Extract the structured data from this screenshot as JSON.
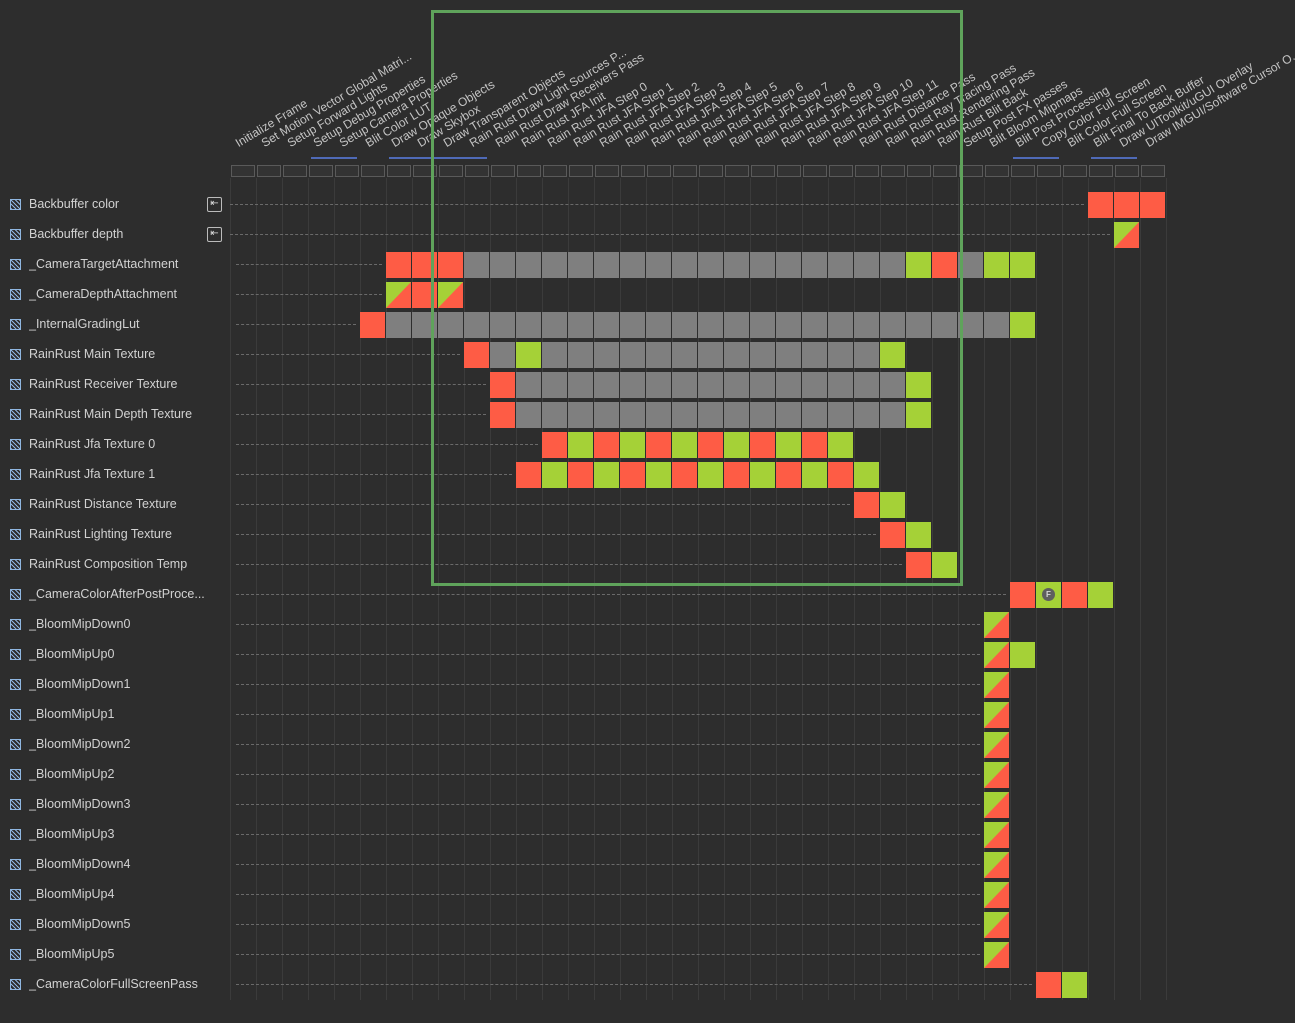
{
  "passes": [
    "Initialize Frame",
    "Set Motion Vector Global Matri...",
    "Setup Forward Lights",
    "Setup Debug Properties",
    "Setup Camera Properties",
    "Blit Color LUT",
    "Draw Opaque Objects",
    "Draw Skybox",
    "Draw Transparent Objects",
    "Rain Rust Draw Light Sources P...",
    "Rain Rust Draw Receivers Pass",
    "Rain Rust JFA Init",
    "Rain Rust JFA Step 0",
    "Rain Rust JFA Step 1",
    "Rain Rust JFA Step 2",
    "Rain Rust JFA Step 3",
    "Rain Rust JFA Step 4",
    "Rain Rust JFA Step 5",
    "Rain Rust JFA Step 6",
    "Rain Rust JFA Step 7",
    "Rain Rust JFA Step 8",
    "Rain Rust JFA Step 9",
    "Rain Rust JFA Step 10",
    "Rain Rust JFA Step 11",
    "Rain Rust Distance Pass",
    "Rain Rust Ray Tracing Pass",
    "Rain Rust Rendering Pass",
    "Rain Rust Blit Back",
    "Setup Post FX passes",
    "Blit Bloom Mipmaps",
    "Blit Post Processing",
    "Copy Color Full Screen",
    "Blit Color Full Screen",
    "Blit Final To Back Buffer",
    "Draw UIToolkit/uGUI Overlay",
    "Draw IMGUI/Software Cursor O..."
  ],
  "merged_pass_groups": [
    [
      3,
      4
    ],
    [
      6,
      9
    ],
    [
      30,
      31
    ],
    [
      33,
      34
    ]
  ],
  "resources": [
    {
      "name": "Backbuffer color",
      "imported": true,
      "cells": [
        [
          33,
          "w"
        ],
        [
          34,
          "w"
        ],
        [
          35,
          "w"
        ]
      ]
    },
    {
      "name": "Backbuffer depth",
      "imported": true,
      "cells": [
        [
          34,
          "rw"
        ]
      ]
    },
    {
      "name": "_CameraTargetAttachment",
      "imported": false,
      "cells": [
        [
          6,
          "w"
        ],
        [
          7,
          "w"
        ],
        [
          8,
          "w"
        ],
        [
          9,
          "g"
        ],
        [
          10,
          "g"
        ],
        [
          11,
          "g"
        ],
        [
          12,
          "g"
        ],
        [
          13,
          "g"
        ],
        [
          14,
          "g"
        ],
        [
          15,
          "g"
        ],
        [
          16,
          "g"
        ],
        [
          17,
          "g"
        ],
        [
          18,
          "g"
        ],
        [
          19,
          "g"
        ],
        [
          20,
          "g"
        ],
        [
          21,
          "g"
        ],
        [
          22,
          "g"
        ],
        [
          23,
          "g"
        ],
        [
          24,
          "g"
        ],
        [
          25,
          "g"
        ],
        [
          26,
          "r"
        ],
        [
          27,
          "w"
        ],
        [
          28,
          "g"
        ],
        [
          29,
          "r"
        ],
        [
          30,
          "r"
        ]
      ]
    },
    {
      "name": "_CameraDepthAttachment",
      "imported": false,
      "cells": [
        [
          6,
          "rw"
        ],
        [
          7,
          "w"
        ],
        [
          8,
          "rw"
        ]
      ]
    },
    {
      "name": "_InternalGradingLut",
      "imported": false,
      "cells": [
        [
          5,
          "w"
        ],
        [
          6,
          "g"
        ],
        [
          7,
          "g"
        ],
        [
          8,
          "g"
        ],
        [
          9,
          "g"
        ],
        [
          10,
          "g"
        ],
        [
          11,
          "g"
        ],
        [
          12,
          "g"
        ],
        [
          13,
          "g"
        ],
        [
          14,
          "g"
        ],
        [
          15,
          "g"
        ],
        [
          16,
          "g"
        ],
        [
          17,
          "g"
        ],
        [
          18,
          "g"
        ],
        [
          19,
          "g"
        ],
        [
          20,
          "g"
        ],
        [
          21,
          "g"
        ],
        [
          22,
          "g"
        ],
        [
          23,
          "g"
        ],
        [
          24,
          "g"
        ],
        [
          25,
          "g"
        ],
        [
          26,
          "g"
        ],
        [
          27,
          "g"
        ],
        [
          28,
          "g"
        ],
        [
          29,
          "g"
        ],
        [
          30,
          "r"
        ]
      ]
    },
    {
      "name": "RainRust Main Texture",
      "imported": false,
      "cells": [
        [
          9,
          "w"
        ],
        [
          10,
          "g"
        ],
        [
          11,
          "r"
        ],
        [
          12,
          "g"
        ],
        [
          13,
          "g"
        ],
        [
          14,
          "g"
        ],
        [
          15,
          "g"
        ],
        [
          16,
          "g"
        ],
        [
          17,
          "g"
        ],
        [
          18,
          "g"
        ],
        [
          19,
          "g"
        ],
        [
          20,
          "g"
        ],
        [
          21,
          "g"
        ],
        [
          22,
          "g"
        ],
        [
          23,
          "g"
        ],
        [
          24,
          "g"
        ],
        [
          25,
          "r"
        ]
      ]
    },
    {
      "name": "RainRust Receiver Texture",
      "imported": false,
      "cells": [
        [
          10,
          "w"
        ],
        [
          11,
          "g"
        ],
        [
          12,
          "g"
        ],
        [
          13,
          "g"
        ],
        [
          14,
          "g"
        ],
        [
          15,
          "g"
        ],
        [
          16,
          "g"
        ],
        [
          17,
          "g"
        ],
        [
          18,
          "g"
        ],
        [
          19,
          "g"
        ],
        [
          20,
          "g"
        ],
        [
          21,
          "g"
        ],
        [
          22,
          "g"
        ],
        [
          23,
          "g"
        ],
        [
          24,
          "g"
        ],
        [
          25,
          "g"
        ],
        [
          26,
          "r"
        ]
      ]
    },
    {
      "name": "RainRust Main Depth Texture",
      "imported": false,
      "cells": [
        [
          10,
          "w"
        ],
        [
          11,
          "g"
        ],
        [
          12,
          "g"
        ],
        [
          13,
          "g"
        ],
        [
          14,
          "g"
        ],
        [
          15,
          "g"
        ],
        [
          16,
          "g"
        ],
        [
          17,
          "g"
        ],
        [
          18,
          "g"
        ],
        [
          19,
          "g"
        ],
        [
          20,
          "g"
        ],
        [
          21,
          "g"
        ],
        [
          22,
          "g"
        ],
        [
          23,
          "g"
        ],
        [
          24,
          "g"
        ],
        [
          25,
          "g"
        ],
        [
          26,
          "r"
        ]
      ]
    },
    {
      "name": "RainRust Jfa Texture 0",
      "imported": false,
      "cells": [
        [
          12,
          "w"
        ],
        [
          13,
          "r"
        ],
        [
          14,
          "w"
        ],
        [
          15,
          "r"
        ],
        [
          16,
          "w"
        ],
        [
          17,
          "r"
        ],
        [
          18,
          "w"
        ],
        [
          19,
          "r"
        ],
        [
          20,
          "w"
        ],
        [
          21,
          "r"
        ],
        [
          22,
          "w"
        ],
        [
          23,
          "r"
        ]
      ]
    },
    {
      "name": "RainRust Jfa Texture 1",
      "imported": false,
      "cells": [
        [
          11,
          "w"
        ],
        [
          12,
          "r"
        ],
        [
          13,
          "w"
        ],
        [
          14,
          "r"
        ],
        [
          15,
          "w"
        ],
        [
          16,
          "r"
        ],
        [
          17,
          "w"
        ],
        [
          18,
          "r"
        ],
        [
          19,
          "w"
        ],
        [
          20,
          "r"
        ],
        [
          21,
          "w"
        ],
        [
          22,
          "r"
        ],
        [
          23,
          "w"
        ],
        [
          24,
          "r"
        ]
      ]
    },
    {
      "name": "RainRust Distance Texture",
      "imported": false,
      "cells": [
        [
          24,
          "w"
        ],
        [
          25,
          "r"
        ]
      ]
    },
    {
      "name": "RainRust Lighting Texture",
      "imported": false,
      "cells": [
        [
          25,
          "w"
        ],
        [
          26,
          "r"
        ]
      ]
    },
    {
      "name": "RainRust Composition Temp",
      "imported": false,
      "cells": [
        [
          26,
          "w"
        ],
        [
          27,
          "r"
        ]
      ]
    },
    {
      "name": "_CameraColorAfterPostProce...",
      "imported": false,
      "cells": [
        [
          30,
          "w"
        ],
        [
          31,
          "f"
        ],
        [
          32,
          "w"
        ],
        [
          33,
          "r"
        ]
      ]
    },
    {
      "name": "_BloomMipDown0",
      "imported": false,
      "cells": [
        [
          29,
          "rw"
        ]
      ]
    },
    {
      "name": "_BloomMipUp0",
      "imported": false,
      "cells": [
        [
          29,
          "rw"
        ],
        [
          30,
          "r"
        ]
      ]
    },
    {
      "name": "_BloomMipDown1",
      "imported": false,
      "cells": [
        [
          29,
          "rw"
        ]
      ]
    },
    {
      "name": "_BloomMipUp1",
      "imported": false,
      "cells": [
        [
          29,
          "rw"
        ]
      ]
    },
    {
      "name": "_BloomMipDown2",
      "imported": false,
      "cells": [
        [
          29,
          "rw"
        ]
      ]
    },
    {
      "name": "_BloomMipUp2",
      "imported": false,
      "cells": [
        [
          29,
          "rw"
        ]
      ]
    },
    {
      "name": "_BloomMipDown3",
      "imported": false,
      "cells": [
        [
          29,
          "rw"
        ]
      ]
    },
    {
      "name": "_BloomMipUp3",
      "imported": false,
      "cells": [
        [
          29,
          "rw"
        ]
      ]
    },
    {
      "name": "_BloomMipDown4",
      "imported": false,
      "cells": [
        [
          29,
          "rw"
        ]
      ]
    },
    {
      "name": "_BloomMipUp4",
      "imported": false,
      "cells": [
        [
          29,
          "rw"
        ]
      ]
    },
    {
      "name": "_BloomMipDown5",
      "imported": false,
      "cells": [
        [
          29,
          "rw"
        ]
      ]
    },
    {
      "name": "_BloomMipUp5",
      "imported": false,
      "cells": [
        [
          29,
          "rw"
        ]
      ]
    },
    {
      "name": "_CameraColorFullScreenPass",
      "imported": false,
      "cells": [
        [
          31,
          "w"
        ],
        [
          32,
          "r"
        ]
      ]
    }
  ],
  "badge_letter": "F",
  "import_icon_glyph": "⇤",
  "colors": {
    "write": "#fe5c45",
    "read": "#a5d137",
    "in_use": "#7f7f7f",
    "merge_bar": "#4f6ab7",
    "highlight_frame": "#5fa35b"
  }
}
